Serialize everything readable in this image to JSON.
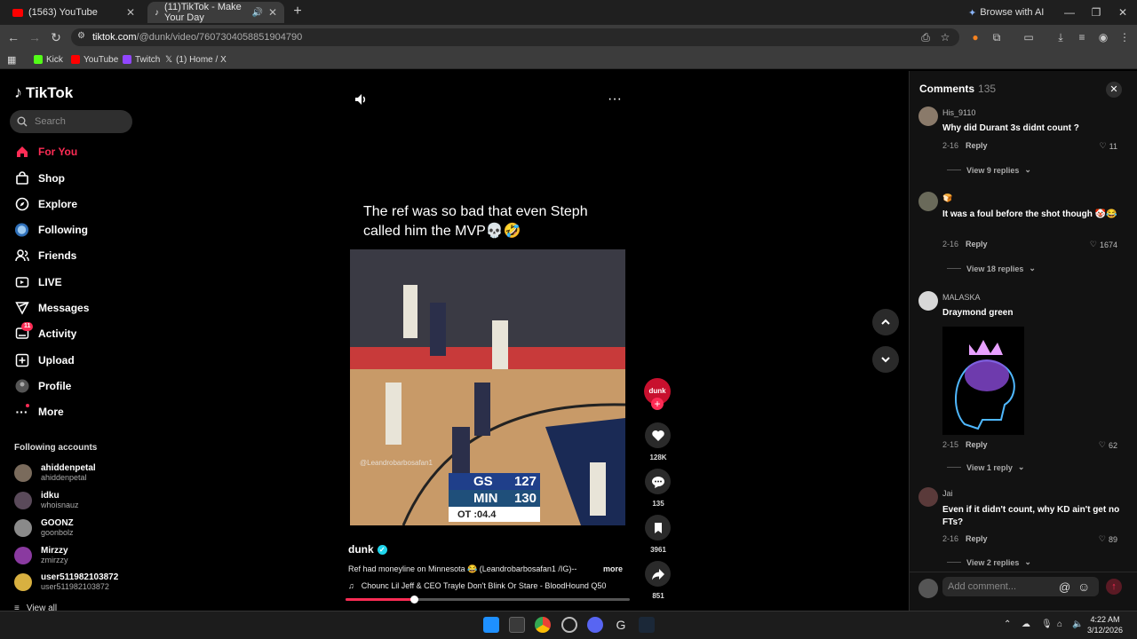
{
  "browser": {
    "tabs": [
      {
        "label": "(1563) YouTube",
        "active": false
      },
      {
        "label": "(11)TikTok - Make Your Day",
        "active": true
      }
    ],
    "browse_ai": "Browse with AI",
    "url_host": "tiktok.com",
    "url_path": "/@dunk/video/7607304058851904790",
    "bookmarks": [
      "Kick",
      "YouTube",
      "Twitch",
      "(1) Home / X"
    ]
  },
  "tiktok": {
    "logo": "TikTok",
    "search_placeholder": "Search",
    "nav": [
      {
        "label": "For You",
        "icon": "home-icon",
        "active": true
      },
      {
        "label": "Shop",
        "icon": "shop-icon"
      },
      {
        "label": "Explore",
        "icon": "compass-icon"
      },
      {
        "label": "Following",
        "icon": "following-icon"
      },
      {
        "label": "Friends",
        "icon": "friends-icon"
      },
      {
        "label": "LIVE",
        "icon": "live-icon"
      },
      {
        "label": "Messages",
        "icon": "messages-icon"
      },
      {
        "label": "Activity",
        "icon": "activity-icon",
        "badge": "11"
      },
      {
        "label": "Upload",
        "icon": "upload-icon"
      },
      {
        "label": "Profile",
        "icon": "profile-icon"
      },
      {
        "label": "More",
        "icon": "more-icon"
      }
    ],
    "following_title": "Following accounts",
    "accounts": [
      {
        "name": "ahiddenpetal",
        "handle": "ahiddenpetal"
      },
      {
        "name": "idku",
        "handle": "whoisnauz"
      },
      {
        "name": "GOONZ",
        "handle": "goonbolz"
      },
      {
        "name": "Mirzzy",
        "handle": "zmirzzy"
      },
      {
        "name": "user511982103872",
        "handle": "user511982103872"
      }
    ],
    "view_all": "View all"
  },
  "video": {
    "caption_top": "The ref was so bad that even Steph called him the MVP💀🤣",
    "watermark": "@Leandrobarbosafan1",
    "score": {
      "gs_team": "GS",
      "gs_pts": "127",
      "min_team": "MIN",
      "min_pts": "130",
      "clock": "OT  :04.4"
    },
    "author": "dunk",
    "author_avatar_text": "dunk",
    "description": "Ref had moneyline on Minnesota 😂 (Leandrobarbosafan1 /IG)--",
    "more": "more",
    "music": "Chounc Lil Jeff & CEO Trayle  Don't Blink Or Stare - BloodHound Q50",
    "progress": 0.24,
    "likes": "128K",
    "comments": "135",
    "saves": "3961",
    "shares": "851"
  },
  "comments": {
    "title": "Comments",
    "count": "135",
    "items": [
      {
        "user": "His_9110",
        "text": "Why did Durant 3s didnt count ?",
        "date": "2-16",
        "likes": "11",
        "replies": "View 9 replies"
      },
      {
        "user": "🍞",
        "text": "It was a foul before the shot though 🤡😂",
        "date": "2-16",
        "likes": "1674",
        "replies": "View 18 replies"
      },
      {
        "user": "MALASKA",
        "text": "Draymond green",
        "date": "2-15",
        "likes": "62",
        "replies": "View 1 reply"
      },
      {
        "user": "Jai",
        "text": "Even if it didn't count, why KD ain't get no FTs?",
        "date": "2-16",
        "likes": "89",
        "replies": "View 2 replies"
      }
    ],
    "reply_label": "Reply",
    "input_placeholder": "Add comment..."
  },
  "taskbar": {
    "time": "4:22 AM",
    "date": "3/12/2026"
  },
  "colors": {
    "accent": "#fe2c55",
    "background": "#000000",
    "panel": "#121212"
  }
}
